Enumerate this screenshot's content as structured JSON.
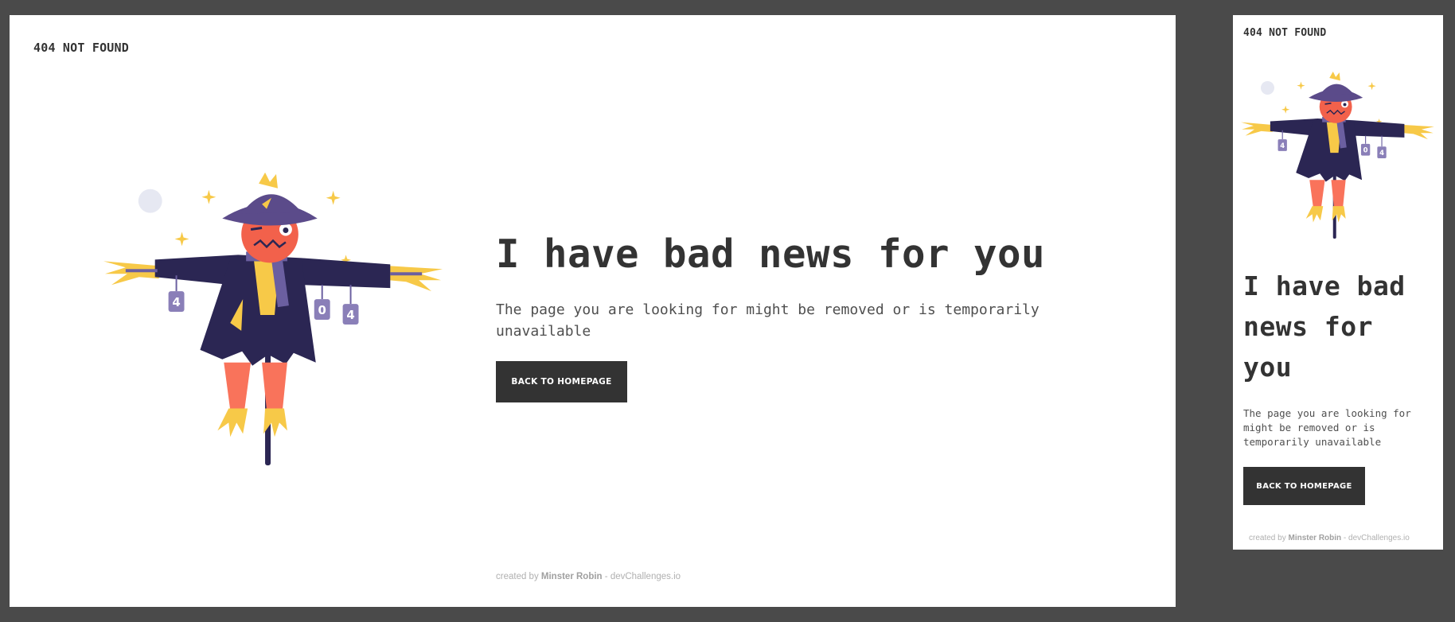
{
  "brand": {
    "title": "404 NOT FOUND"
  },
  "hero": {
    "headline": "I have bad news for you",
    "mobile_headline_lines": [
      "I have bad",
      "news for",
      "you"
    ],
    "description": "The page you are looking for might be removed or is temporarily unavailable",
    "cta_label": "BACK TO HOMEPAGE"
  },
  "illustration": {
    "alt": "scarecrow",
    "sign_labels": [
      "4",
      "0",
      "4"
    ],
    "colors": {
      "hat": "#5b4b8a",
      "coat": "#2b2653",
      "face": "#f2614b",
      "straw": "#f7c948",
      "scarf": "#6b5fa0",
      "moon": "#e6e8f2",
      "pole": "#2b2653",
      "pants": "#f9735b"
    }
  },
  "footer": {
    "prefix": "created by",
    "author": "Minster Robin",
    "separator": " - ",
    "site": "devChallenges.io"
  },
  "colors": {
    "background": "#4a4a4a",
    "card": "#ffffff",
    "text": "#333333",
    "button": "#333333",
    "button_text": "#ffffff"
  }
}
